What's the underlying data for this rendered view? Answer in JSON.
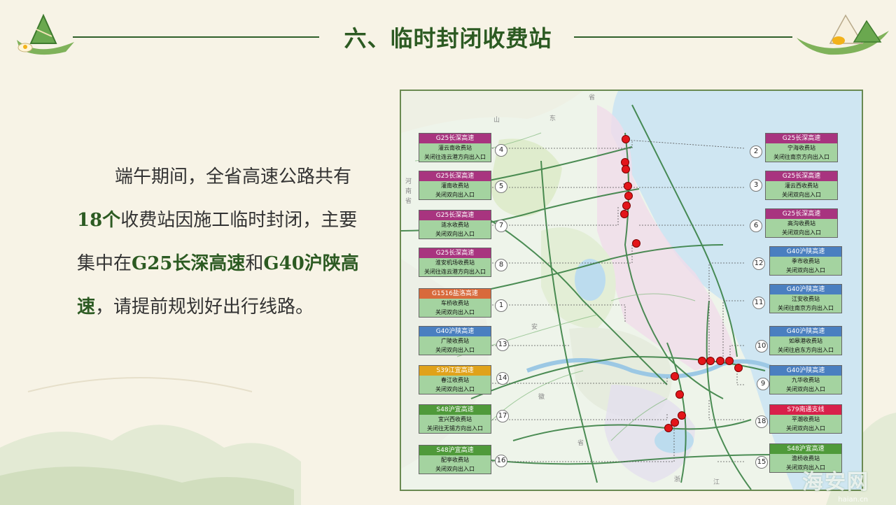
{
  "title": "六、临时封闭收费站",
  "paragraph": {
    "p1": "端午期间，全省高速公路共有",
    "b1": "18个",
    "p2": "收费站因施工临时封闭，主要集中在",
    "b2": "G25长深高速",
    "p3": "和",
    "b3": "G40沪陕高速",
    "p4": "，请提前规划好出行线路。"
  },
  "map_labels": [
    "山",
    "东",
    "省",
    "河",
    "南",
    "省",
    "安",
    "徽",
    "省",
    "浙",
    "江"
  ],
  "colors": {
    "G25": "#a8347f",
    "G40": "#4a7fc0",
    "G1516": "#d86a3c",
    "S39": "#e0a21a",
    "S48": "#4f9a3a",
    "S79": "#d8204a",
    "card_bg": "#a4d3a0",
    "closed_dot": "#e3151a"
  },
  "stations": [
    {
      "num": "4",
      "road": "G25长深高速",
      "name": "灌云南收费站",
      "note": "关闭往连云港方向出入口",
      "color_key": "G25"
    },
    {
      "num": "5",
      "road": "G25长深高速",
      "name": "灌南收费站",
      "note": "关闭双向出入口",
      "color_key": "G25"
    },
    {
      "num": "7",
      "road": "G25长深高速",
      "name": "涟水收费站",
      "note": "关闭双向出入口",
      "color_key": "G25"
    },
    {
      "num": "8",
      "road": "G25长深高速",
      "name": "淮安机场收费站",
      "note": "关闭往连云港方向出入口",
      "color_key": "G25"
    },
    {
      "num": "1",
      "road": "G1516盐洛高速",
      "name": "车桥收费站",
      "note": "关闭双向出入口",
      "color_key": "G1516"
    },
    {
      "num": "13",
      "road": "G40沪陕高速",
      "name": "广陵收费站",
      "note": "关闭双向出入口",
      "color_key": "G40"
    },
    {
      "num": "14",
      "road": "S39江宜高速",
      "name": "春江收费站",
      "note": "关闭双向出入口",
      "color_key": "S39"
    },
    {
      "num": "17",
      "road": "S48沪宜高速",
      "name": "宜兴西收费站",
      "note": "关闭往无锡方向出入口",
      "color_key": "S48"
    },
    {
      "num": "16",
      "road": "S48沪宜高速",
      "name": "配亭收费站",
      "note": "关闭双向出入口",
      "color_key": "S48"
    },
    {
      "num": "2",
      "road": "G25长深高速",
      "name": "宁海收费站",
      "note": "关闭往南京方向出入口",
      "color_key": "G25"
    },
    {
      "num": "3",
      "road": "G25长深高速",
      "name": "灌云西收费站",
      "note": "关闭双向出入口",
      "color_key": "G25"
    },
    {
      "num": "6",
      "road": "G25长深高速",
      "name": "高沟收费站",
      "note": "关闭双向出入口",
      "color_key": "G25"
    },
    {
      "num": "12",
      "road": "G40沪陕高速",
      "name": "季市收费站",
      "note": "关闭双向出入口",
      "color_key": "G40"
    },
    {
      "num": "11",
      "road": "G40沪陕高速",
      "name": "江安收费站",
      "note": "关闭往南京方向出入口",
      "color_key": "G40"
    },
    {
      "num": "10",
      "road": "G40沪陕高速",
      "name": "如皋港收费站",
      "note": "关闭往启东方向出入口",
      "color_key": "G40"
    },
    {
      "num": "9",
      "road": "G40沪陕高速",
      "name": "九华收费站",
      "note": "关闭双向出入口",
      "color_key": "G40"
    },
    {
      "num": "18",
      "road": "S79南通支线",
      "name": "平潮收费站",
      "note": "关闭双向出入口",
      "color_key": "S79"
    },
    {
      "num": "15",
      "road": "S48沪宜高速",
      "name": "澹桥收费站",
      "note": "关闭双向出入口",
      "color_key": "S48"
    }
  ],
  "watermark": {
    "main": "海安网",
    "sub": "haian.cn"
  }
}
